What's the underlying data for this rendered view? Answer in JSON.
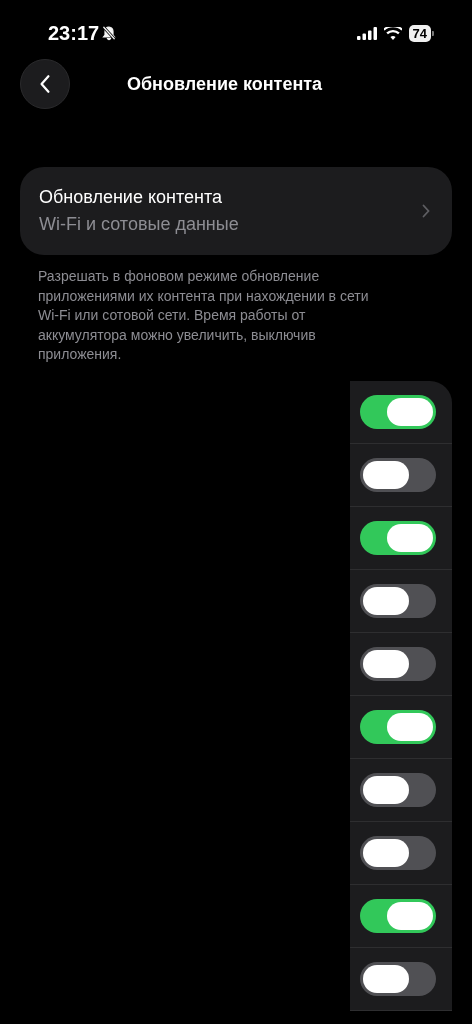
{
  "status_bar": {
    "time": "23:17",
    "battery": "74"
  },
  "nav": {
    "title": "Обновление контента"
  },
  "setting": {
    "title": "Обновление контента",
    "value": "Wi-Fi и сотовые данные"
  },
  "footer": "Разрешать в фоновом режиме обновление приложениями их контента при нахождении в сети Wi-Fi или сотовой сети. Время работы от аккумулятора можно увеличить, выключив приложения.",
  "apps": [
    {
      "on": true
    },
    {
      "on": false
    },
    {
      "on": true
    },
    {
      "on": false
    },
    {
      "on": false
    },
    {
      "on": true
    },
    {
      "on": false
    },
    {
      "on": false
    },
    {
      "on": true
    },
    {
      "on": false
    }
  ]
}
